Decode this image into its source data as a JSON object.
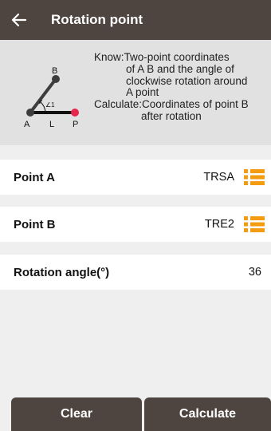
{
  "header": {
    "title": "Rotation point"
  },
  "info": {
    "diagram_labels": {
      "a": "A",
      "b": "B",
      "l": "L",
      "p": "P",
      "angle": "∠1"
    },
    "lines": [
      "Know:Two-point coordinates",
      "of A B and the angle of",
      "clockwise rotation around",
      "A point",
      "Calculate:Coordinates of point B",
      "after rotation"
    ]
  },
  "fields": {
    "point_a": {
      "label": "Point A",
      "value": "TRSA"
    },
    "point_b": {
      "label": "Point B",
      "value": "TRE2"
    },
    "rotation_angle": {
      "label": "Rotation angle(°)",
      "value": "36"
    }
  },
  "buttons": {
    "clear": "Clear",
    "calculate": "Calculate"
  },
  "colors": {
    "header_bg": "#4f4540",
    "accent_orange": "#f39c12",
    "point_red": "#e8254a",
    "info_bg": "#e1e1e1"
  },
  "icons": {
    "back": "arrow-left-icon",
    "list": "list-icon"
  }
}
